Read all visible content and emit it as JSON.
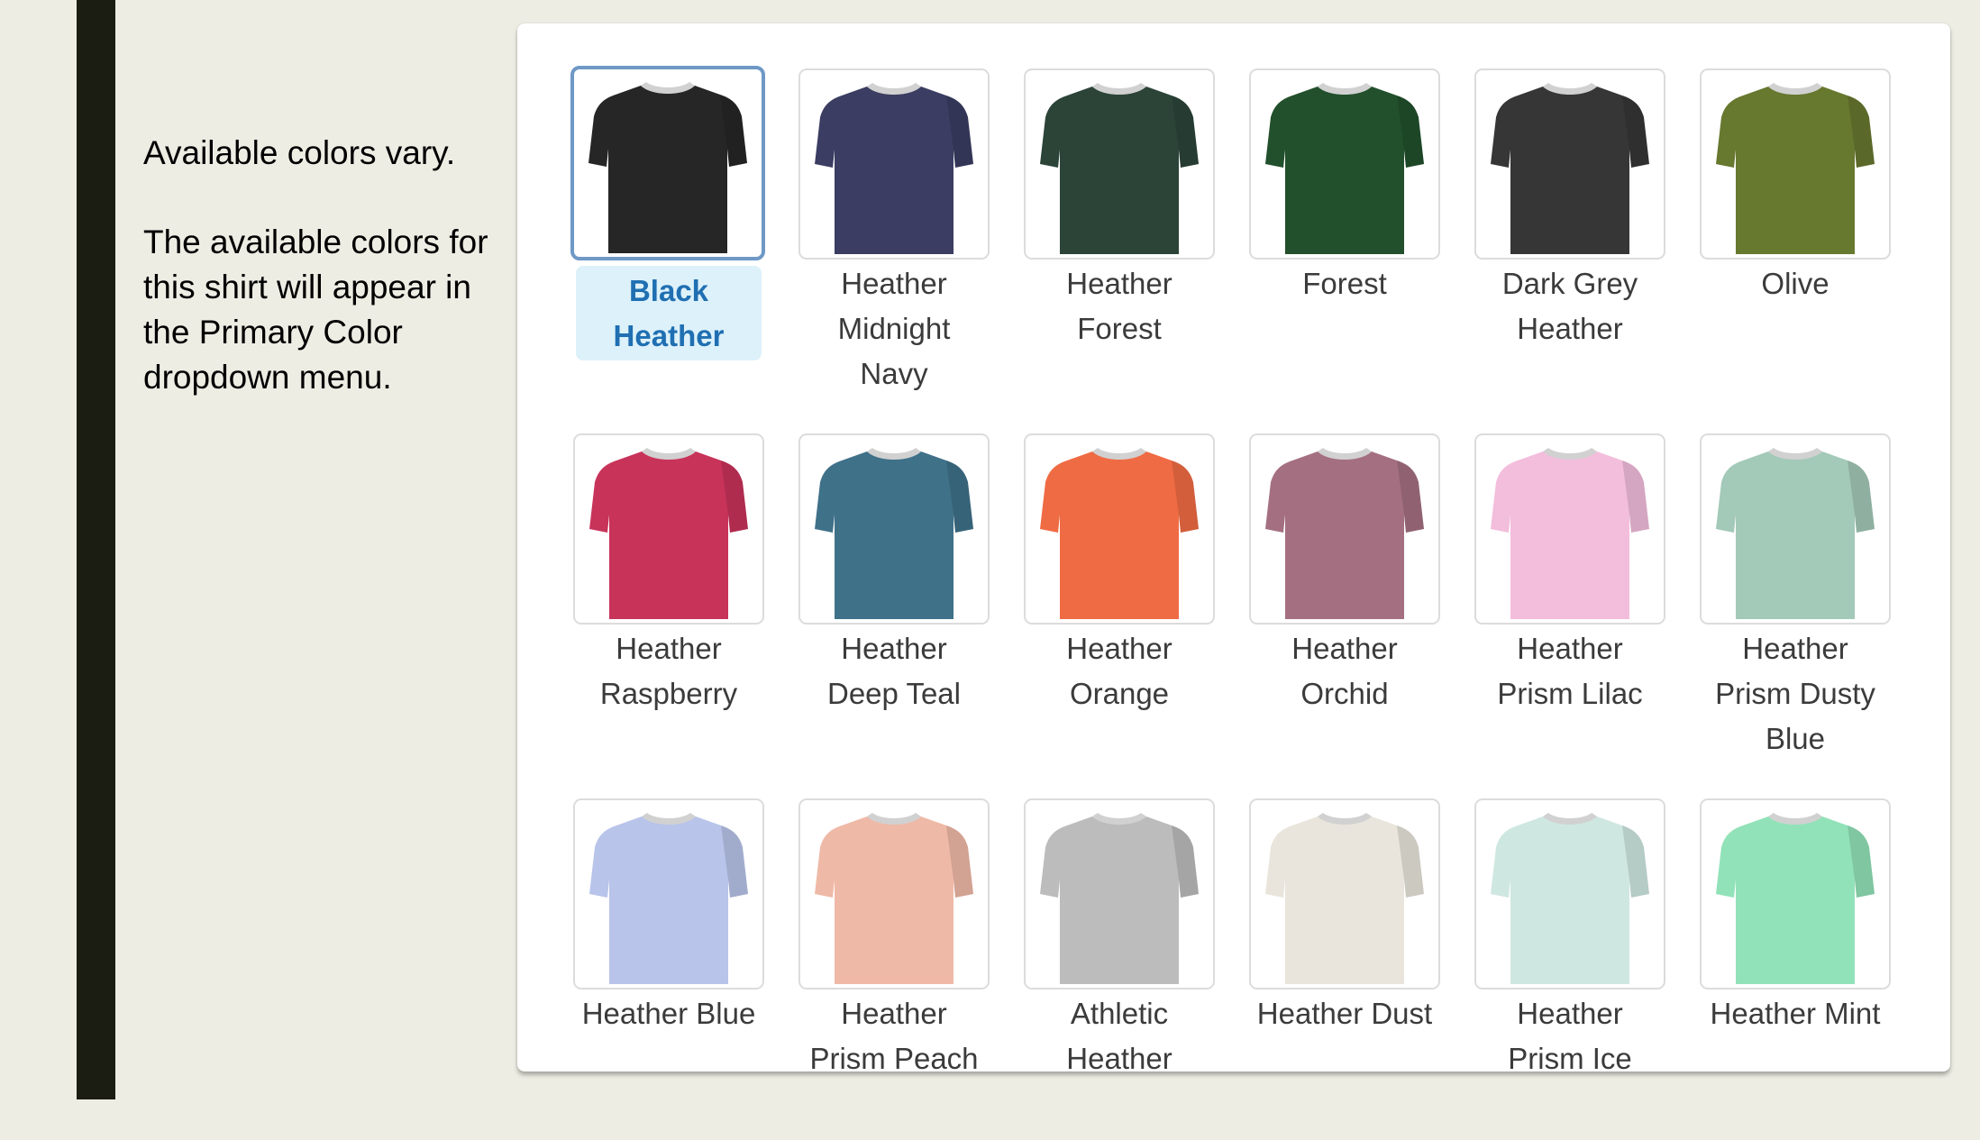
{
  "sidebar_note": {
    "line1": "Available colors vary.",
    "line2": "The available colors for this shirt will appear in the Primary Color dropdown menu."
  },
  "selected_color": "Black Heather",
  "colors": [
    {
      "name": "Black\nHeather",
      "hex": "#262626",
      "selected": true
    },
    {
      "name": "Heather\nMidnight\nNavy",
      "hex": "#3b3d62",
      "selected": false
    },
    {
      "name": "Heather\nForest",
      "hex": "#2c4438",
      "selected": false
    },
    {
      "name": "Forest",
      "hex": "#22502c",
      "selected": false
    },
    {
      "name": "Dark Grey\nHeather",
      "hex": "#363636",
      "selected": false
    },
    {
      "name": "Olive",
      "hex": "#67782f",
      "selected": false
    },
    {
      "name": "Heather\nRaspberry",
      "hex": "#c8335a",
      "selected": false
    },
    {
      "name": "Heather\nDeep Teal",
      "hex": "#3f7189",
      "selected": false
    },
    {
      "name": "Heather\nOrange",
      "hex": "#ef6b44",
      "selected": false
    },
    {
      "name": "Heather\nOrchid",
      "hex": "#a47081",
      "selected": false
    },
    {
      "name": "Heather\nPrism Lilac",
      "hex": "#f3bddc",
      "selected": false
    },
    {
      "name": "Heather\nPrism Dusty\nBlue",
      "hex": "#a3c9b8",
      "selected": false
    },
    {
      "name": "Heather Blue",
      "hex": "#b8c4ea",
      "selected": false
    },
    {
      "name": "Heather\nPrism Peach",
      "hex": "#efb9a7",
      "selected": false
    },
    {
      "name": "Athletic\nHeather",
      "hex": "#bcbcbc",
      "selected": false
    },
    {
      "name": "Heather Dust",
      "hex": "#e9e5dc",
      "selected": false
    },
    {
      "name": "Heather\nPrism Ice",
      "hex": "#cfe7e1",
      "selected": false
    },
    {
      "name": "Heather Mint",
      "hex": "#91e2b8",
      "selected": false
    }
  ]
}
